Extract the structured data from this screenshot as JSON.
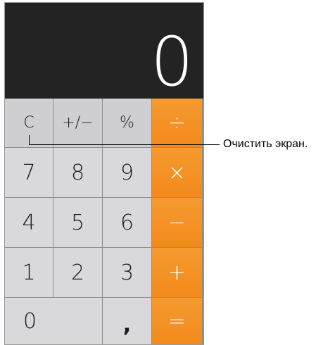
{
  "display": {
    "value": "0"
  },
  "keys": {
    "clear": "C",
    "sign": "+/−",
    "percent": "%",
    "divide": "÷",
    "seven": "7",
    "eight": "8",
    "nine": "9",
    "multiply": "×",
    "four": "4",
    "five": "5",
    "six": "6",
    "minus": "−",
    "one": "1",
    "two": "2",
    "three": "3",
    "plus": "+",
    "zero": "0",
    "comma": ",",
    "equals": "="
  },
  "callout": {
    "text": "Очистить экран."
  },
  "colors": {
    "display_bg": "#232323",
    "function_key": "#cfcfd2",
    "number_key": "#d9d9dc",
    "operator_key": "#f5912a"
  }
}
